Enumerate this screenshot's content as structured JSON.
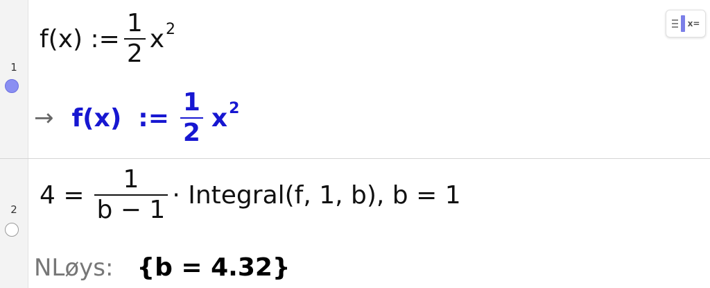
{
  "menu": {
    "icon": "algebra-input-toggle-icon",
    "text": "x="
  },
  "rows": [
    {
      "number": "1",
      "toggle": "on",
      "input": {
        "lhs": "f(x) :=",
        "num": "1",
        "den": "2",
        "var": "x",
        "exp": "2"
      },
      "output": {
        "arrow": "→",
        "lhs": "f(x)",
        "op": ":=",
        "num": "1",
        "den": "2",
        "var": "x",
        "exp": "2"
      }
    },
    {
      "number": "2",
      "toggle": "off",
      "input": {
        "lhs": "4 =",
        "num": "1",
        "den": "b − 1",
        "rest": "· Integral(f, 1, b), b = 1"
      },
      "output": {
        "label": "NLøys:",
        "result": "{b = 4.32}"
      }
    }
  ],
  "colors": {
    "output": "#1717d1",
    "toggle_on": "#8a8ff2"
  }
}
